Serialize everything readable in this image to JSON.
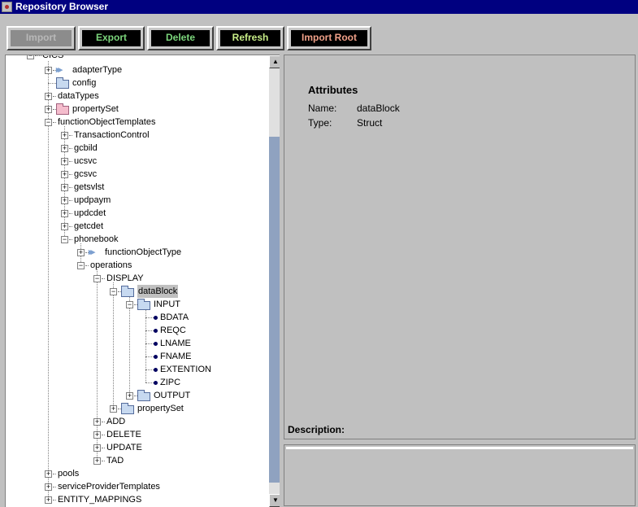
{
  "window": {
    "title": "Repository Browser"
  },
  "toolbar": {
    "buttons": [
      {
        "label": "Import",
        "enabled": false,
        "color": "#b8b8b8"
      },
      {
        "label": "Export",
        "enabled": true,
        "color": "#7cd67c"
      },
      {
        "label": "Delete",
        "enabled": true,
        "color": "#7cd67c"
      },
      {
        "label": "Refresh",
        "enabled": true,
        "color": "#c8ee88"
      },
      {
        "label": "Import Root",
        "enabled": true,
        "color": "#f0a088"
      }
    ]
  },
  "tree": {
    "root_label": "CICS",
    "nodes": [
      {
        "label": "adapterType",
        "icon": "arrows",
        "expander": "plus"
      },
      {
        "label": "config",
        "icon": "folder",
        "expander": "none"
      },
      {
        "label": "dataTypes",
        "icon": "none",
        "expander": "plus"
      },
      {
        "label": "propertySet",
        "icon": "folder-pink",
        "expander": "plus"
      },
      {
        "label": "functionObjectTemplates",
        "icon": "none",
        "expander": "minus"
      },
      {
        "label": "TransactionControl",
        "icon": "none",
        "expander": "plus"
      },
      {
        "label": "gcbild",
        "icon": "none",
        "expander": "plus"
      },
      {
        "label": "ucsvc",
        "icon": "none",
        "expander": "plus"
      },
      {
        "label": "gcsvc",
        "icon": "none",
        "expander": "plus"
      },
      {
        "label": "getsvlst",
        "icon": "none",
        "expander": "plus"
      },
      {
        "label": "updpaym",
        "icon": "none",
        "expander": "plus"
      },
      {
        "label": "updcdet",
        "icon": "none",
        "expander": "plus"
      },
      {
        "label": "getcdet",
        "icon": "none",
        "expander": "plus"
      },
      {
        "label": "phonebook",
        "icon": "none",
        "expander": "minus"
      },
      {
        "label": "functionObjectType",
        "icon": "arrows",
        "expander": "plus"
      },
      {
        "label": "operations",
        "icon": "none",
        "expander": "minus"
      },
      {
        "label": "DISPLAY",
        "icon": "none",
        "expander": "minus"
      },
      {
        "label": "dataBlock",
        "icon": "folder",
        "expander": "minus",
        "selected": true
      },
      {
        "label": "INPUT",
        "icon": "folder",
        "expander": "minus"
      },
      {
        "label": "BDATA",
        "icon": "bullet",
        "expander": "none"
      },
      {
        "label": "REQC",
        "icon": "bullet",
        "expander": "none"
      },
      {
        "label": "LNAME",
        "icon": "bullet",
        "expander": "none"
      },
      {
        "label": "FNAME",
        "icon": "bullet",
        "expander": "none"
      },
      {
        "label": "EXTENTION",
        "icon": "bullet",
        "expander": "none"
      },
      {
        "label": "ZIPC",
        "icon": "bullet",
        "expander": "none"
      },
      {
        "label": "OUTPUT",
        "icon": "folder",
        "expander": "plus"
      },
      {
        "label": "propertySet",
        "icon": "folder",
        "expander": "plus"
      },
      {
        "label": "ADD",
        "icon": "none",
        "expander": "plus"
      },
      {
        "label": "DELETE",
        "icon": "none",
        "expander": "plus"
      },
      {
        "label": "UPDATE",
        "icon": "none",
        "expander": "plus"
      },
      {
        "label": "TAD",
        "icon": "none",
        "expander": "plus"
      },
      {
        "label": "pools",
        "icon": "none",
        "expander": "plus"
      },
      {
        "label": "serviceProviderTemplates",
        "icon": "none",
        "expander": "plus"
      },
      {
        "label": "ENTITY_MAPPINGS",
        "icon": "none",
        "expander": "plus"
      }
    ]
  },
  "attributes": {
    "heading": "Attributes",
    "name_key": "Name:",
    "name_value": "dataBlock",
    "type_key": "Type:",
    "type_value": "Struct",
    "description_label": "Description:"
  },
  "description": {
    "text": ""
  }
}
